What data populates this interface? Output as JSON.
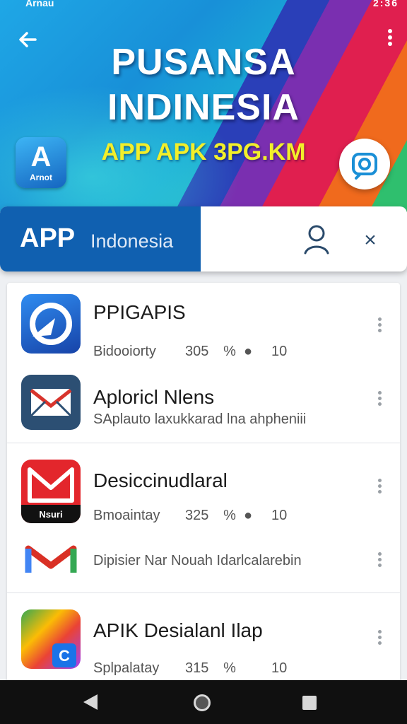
{
  "status_bar": {
    "left_text": "Arnau",
    "right_text": "2:36"
  },
  "header": {
    "title_line1": "PUSANSA",
    "title_line2": "INDINESIA",
    "subtitle": "APP APK 3PG.KM",
    "logo_label": "Arnot"
  },
  "search": {
    "app_label": "APP",
    "region_label": "Indonesia"
  },
  "apps": [
    {
      "title": "PPIGAPIS",
      "category": "Bidooiorty",
      "size": "305",
      "count": "10",
      "icon": "app-blue-icon"
    },
    {
      "title": "Aploricl Nlens",
      "description": "SAplauto laxukkarad lna ahpheniii",
      "icon": "mail-envelope-icon"
    },
    {
      "title": "Desiccinudlaral",
      "category": "Bmoaintay",
      "size": "325",
      "count": "10",
      "icon": "red-app-icon"
    },
    {
      "description": "Dipisier Nar Nouah Idarlcalarebin",
      "icon": "gmail-icon"
    },
    {
      "title": "APIK Desialanl Ilap",
      "category": "Splpalatay",
      "size": "315",
      "count": "10",
      "icon": "colorful-app-icon"
    }
  ],
  "colors": {
    "bar_blue": "#1060b0",
    "subtitle_yellow": "#f2ef2a",
    "text_dark": "#1b1b1b"
  }
}
